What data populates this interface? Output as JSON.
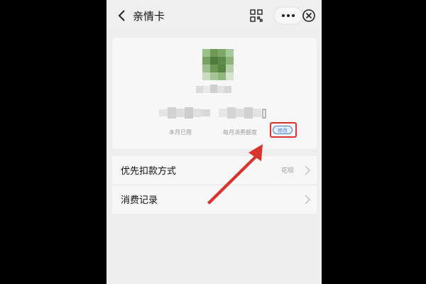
{
  "nav": {
    "title": "亲情卡",
    "icons": [
      "chevron-left-icon",
      "scan-icon",
      "more-icon",
      "close-icon"
    ]
  },
  "card": {
    "used_caption": "本月已用",
    "limit_caption": "每月消费额度",
    "modify_label": "修改"
  },
  "menu": {
    "items": [
      {
        "label": "优先扣款方式",
        "value": "花呗"
      },
      {
        "label": "消费记录",
        "value": ""
      }
    ]
  },
  "colors": {
    "highlight": "#d9342b",
    "link": "#3f7fd0",
    "background": "#eeeeee"
  }
}
